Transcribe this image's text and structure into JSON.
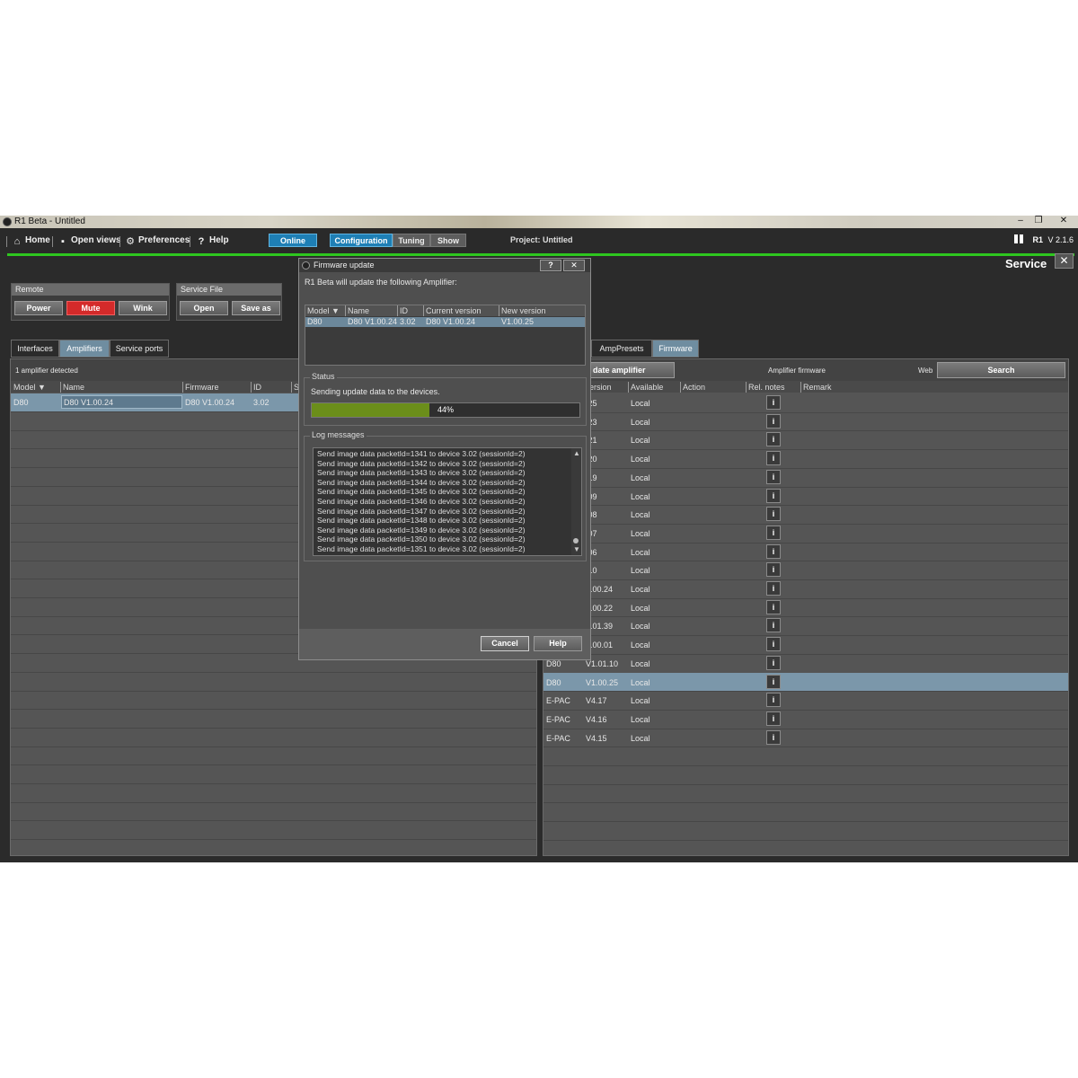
{
  "window": {
    "title": "R1 Beta - Untitled",
    "minimize": "–",
    "restore": "❐",
    "close": "✕"
  },
  "menubar": {
    "home": "Home",
    "open_views": "Open views",
    "preferences": "Preferences",
    "help": "Help",
    "online": "Online",
    "configuration": "Configuration",
    "tuning": "Tuning",
    "show": "Show",
    "project_label": "Project:",
    "project_name": "Untitled",
    "brand": "R1",
    "version": "V 2.1.6"
  },
  "service": {
    "title": "Service",
    "close": "✕"
  },
  "remote": {
    "label": "Remote",
    "power": "Power",
    "mute": "Mute",
    "wink": "Wink"
  },
  "service_file": {
    "label": "Service File",
    "open": "Open",
    "save_as": "Save as"
  },
  "left_tabs": [
    "Interfaces",
    "Amplifiers",
    "Service ports"
  ],
  "amplifiers": {
    "detected": "1 amplifier detected",
    "columns": [
      "Model ▼",
      "Name",
      "Firmware",
      "ID",
      "S"
    ],
    "rows": [
      {
        "model": "D80",
        "name": "D80 V1.00.24",
        "firmware": "D80 V1.00.24",
        "id": "3.02"
      }
    ]
  },
  "right_tabs": [
    "AmpPresets",
    "Firmware"
  ],
  "firmware": {
    "update_button": "date amplifier",
    "amplifier_firmware": "Amplifier firmware",
    "web": "Web",
    "search": "Search",
    "columns": [
      "ersion",
      "Available",
      "Action",
      "Rel. notes",
      "Remark"
    ],
    "info": "i",
    "rows": [
      {
        "model": "",
        "version": ".25",
        "available": "Local"
      },
      {
        "model": "",
        "version": ".23",
        "available": "Local"
      },
      {
        "model": "",
        "version": ".21",
        "available": "Local"
      },
      {
        "model": "",
        "version": ".20",
        "available": "Local"
      },
      {
        "model": "",
        "version": ".19",
        "available": "Local"
      },
      {
        "model": "",
        "version": ".09",
        "available": "Local"
      },
      {
        "model": "",
        "version": ".08",
        "available": "Local"
      },
      {
        "model": "",
        "version": ".07",
        "available": "Local"
      },
      {
        "model": "",
        "version": ".06",
        "available": "Local"
      },
      {
        "model": "",
        "version": ".10",
        "available": "Local"
      },
      {
        "model": "",
        "version": "1.00.24",
        "available": "Local"
      },
      {
        "model": "",
        "version": "1.00.22",
        "available": "Local"
      },
      {
        "model": "",
        "version": "1.01.39",
        "available": "Local"
      },
      {
        "model": "",
        "version": "1.00.01",
        "available": "Local"
      },
      {
        "model": "D80",
        "version": "V1.01.10",
        "available": "Local"
      },
      {
        "model": "D80",
        "version": "V1.00.25",
        "available": "Local",
        "selected": true
      },
      {
        "model": "E-PAC",
        "version": "V4.17",
        "available": "Local"
      },
      {
        "model": "E-PAC",
        "version": "V4.16",
        "available": "Local"
      },
      {
        "model": "E-PAC",
        "version": "V4.15",
        "available": "Local"
      }
    ]
  },
  "dialog": {
    "title": "Firmware update",
    "help_q": "?",
    "close": "✕",
    "intro": "R1 Beta will update the following Amplifier:",
    "columns": [
      "Model ▼",
      "Name",
      "ID",
      "Current version",
      "New version"
    ],
    "row": {
      "model": "D80",
      "name": "D80 V1.00.24",
      "id": "3.02",
      "current": "D80 V1.00.24",
      "new": "V1.00.25"
    },
    "status_label": "Status",
    "status_text": "Sending update data to the devices.",
    "progress": 0.44,
    "progress_text": "44%",
    "log_label": "Log messages",
    "log": [
      "Send image data packetId=1341 to device 3.02 (sessionId=2)",
      "Send image data packetId=1342 to device 3.02 (sessionId=2)",
      "Send image data packetId=1343 to device 3.02 (sessionId=2)",
      "Send image data packetId=1344 to device 3.02 (sessionId=2)",
      "Send image data packetId=1345 to device 3.02 (sessionId=2)",
      "Send image data packetId=1346 to device 3.02 (sessionId=2)",
      "Send image data packetId=1347 to device 3.02 (sessionId=2)",
      "Send image data packetId=1348 to device 3.02 (sessionId=2)",
      "Send image data packetId=1349 to device 3.02 (sessionId=2)",
      "Send image data packetId=1350 to device 3.02 (sessionId=2)",
      "Send image data packetId=1351 to device 3.02 (sessionId=2)"
    ],
    "cancel": "Cancel",
    "help": "Help"
  }
}
